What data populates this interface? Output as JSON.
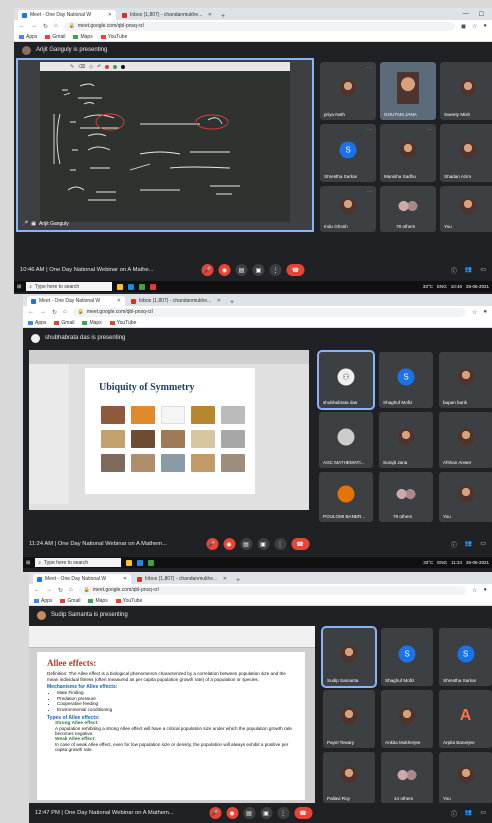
{
  "browser": {
    "tab_meet": "Meet - One Day National W",
    "tab_meet_short": "Meet - One Day National W",
    "tab_inbox": "Inbox (1,807) - chandanmukhe...",
    "url": "meet.google.com/qbl-pnsq-rzl",
    "bookmarks": [
      "Apps",
      "Gmail",
      "Maps",
      "YouTube"
    ]
  },
  "shot1": {
    "presenting_banner": "Arijit Ganguly is presenting",
    "presenter": "Arijit Ganguly",
    "time": "10:46 AM",
    "meeting_title": "One Day National Webinar on A Mathe...",
    "participants": [
      "priya Nath",
      "GOUTAM JANA",
      "Sweety Mish",
      "Shrestha Sarkar",
      "Manisha Sadhu",
      "Shadan Azim",
      "Indu Ghosh",
      "79 others",
      "You"
    ],
    "initials": {
      "shrestha": "S"
    },
    "taskbar_search": "Type here to search",
    "weather": "33°C",
    "lang": "ENG",
    "clock_time": "10:46",
    "clock_date": "25-06-2021"
  },
  "shot2": {
    "presenting_banner": "shubhabrata das is presenting",
    "slide_title": "Ubiquity of Symmetry",
    "time": "11:24 AM",
    "meeting_title": "One Day National Webinar on A Mathem...",
    "participants": [
      "shubhabrata das",
      "Shaghuf Mofiz",
      "bapan barik",
      "AGC MATHEMATI...",
      "Surajit Jana",
      "Afshan Anwer",
      "POULOMI BANER...",
      "79 others",
      "You"
    ],
    "initials": {
      "shaghuf": "S"
    },
    "taskbar_search": "Type here to search",
    "weather": "33°C",
    "lang": "ENG",
    "clock_time": "11:24",
    "clock_date": "25-06-2021"
  },
  "shot3": {
    "presenting_banner": "Sudip Samanta is presenting",
    "doc_title": "Allee effects:",
    "definition": "Definition: The Allee effect is a biological phenomenon characterized by a correlation between population size and the mean individual fitness (often measured as per capita population growth rate) of a population or species.",
    "mechanisms_heading": "Mechanisms for Allee effects:",
    "mechanisms": [
      "Mate Finding",
      "Predation pressure",
      "Cooperative feeding",
      "Environmental conditioning"
    ],
    "types_heading": "Types of Allee effects:",
    "strong_heading": "Strong Allee effect:",
    "strong_text": "A population exhibiting a strong Allee effect will have a critical population size under which the population growth rate becomes negative.",
    "weak_heading": "Weak Allee effect:",
    "weak_text": "In case of weak Allee effect, even for low population size or density, the population will always exhibit a positive per capita growth rate.",
    "time": "12:47 PM",
    "meeting_title": "One Day National Webinar on A Mathem...",
    "participants": [
      "Sudip Samanta",
      "Shaghuf Mofiz",
      "Shrestha Sarkar",
      "Payel Tewary",
      "Ankita Mukherjee",
      "Arpita Banerjee",
      "Pallavi Roy",
      "44 others",
      "You"
    ],
    "initials": {
      "shaghuf": "S",
      "shrestha": "S",
      "arpita": "A"
    }
  },
  "colors": {
    "meet_bg": "#202124",
    "tile_bg": "#3c4043",
    "accent": "#8ab4f8",
    "end_call": "#ea4335"
  }
}
